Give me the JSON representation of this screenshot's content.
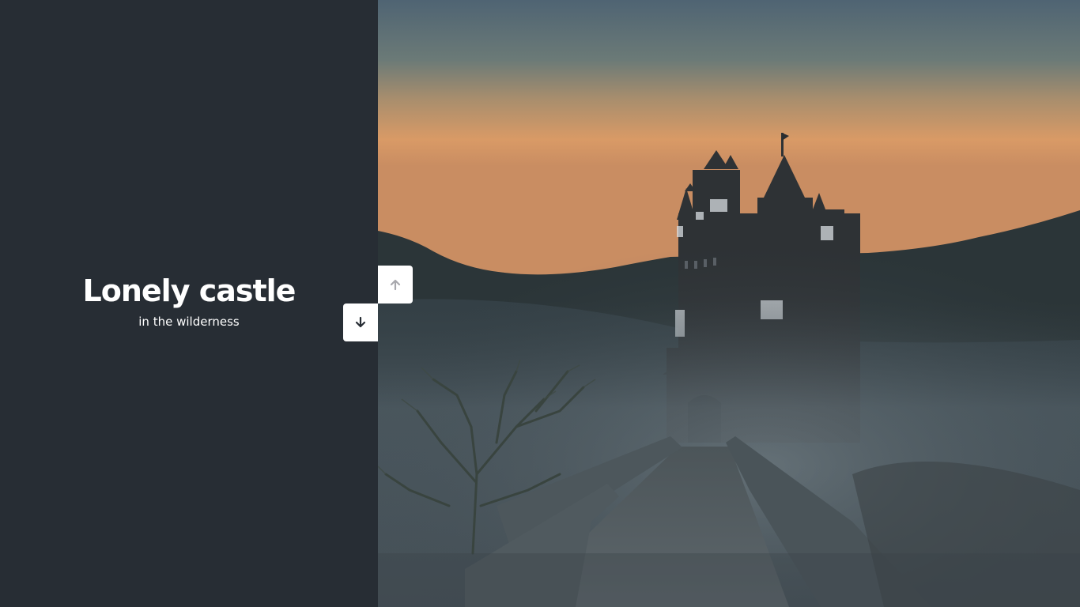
{
  "slide": {
    "title": "Lonely castle",
    "subtitle": "in the wilderness"
  },
  "image": {
    "subject": "castle-in-fog"
  },
  "controls": {
    "up_icon": "arrow-up-icon",
    "down_icon": "arrow-down-icon"
  },
  "colors": {
    "panel_bg": "#272d34",
    "button_bg": "#ffffff",
    "up_arrow": "#a8a8ad",
    "down_arrow": "#272d34"
  }
}
